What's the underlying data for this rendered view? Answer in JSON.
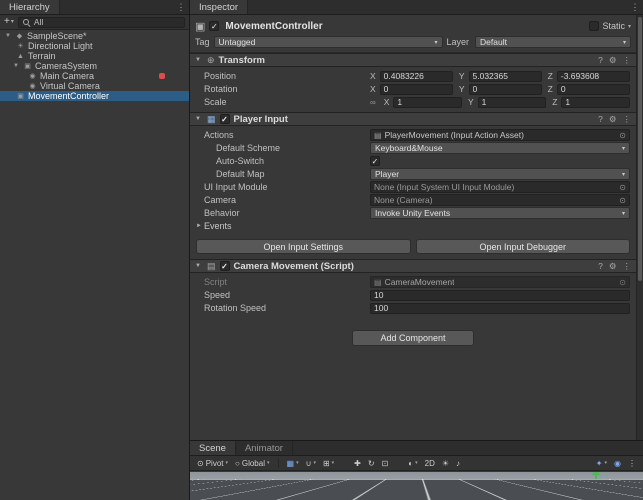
{
  "colors": {
    "selection_blue": "#2C5D87",
    "panel_bg": "#383838",
    "component_header_bg": "#3E3E3E",
    "field_bg": "#2A2A2A",
    "button_bg": "#585858",
    "active_icon_blue": "#7BAAF7",
    "warning_red": "#E04B4B",
    "gizmo_green": "#4CBB4C"
  },
  "icons": {
    "menu_dots": "⋮",
    "dropdown_arrow": "▾",
    "foldout_open": "▼",
    "foldout_closed": "►",
    "plus": "+",
    "check": "✓",
    "help": "?",
    "preset": "⚙",
    "object_picker": "⊙",
    "link": "∞",
    "scene": "◆",
    "light": "☀",
    "terrain": "▲",
    "gameobject": "▣",
    "camera": "◉",
    "transform_tool": "⊕",
    "gamepad": "▦",
    "script": "▤",
    "asset": "▤",
    "pivot": "⊙",
    "globe": "○",
    "grid": "▦",
    "snap": "⊞",
    "magnet": "∪",
    "pan": "✚",
    "orbit": "↻",
    "frame": "⊡",
    "shaded": "◐",
    "audio": "♪",
    "effects": "✦",
    "gizmo": "◉"
  },
  "hierarchy": {
    "tab_label": "Hierarchy",
    "search_label": "All",
    "scene_label": "SampleScene*",
    "items": [
      {
        "label": "Directional Light"
      },
      {
        "label": "Terrain"
      },
      {
        "label": "CameraSystem"
      },
      {
        "label": "Main Camera"
      },
      {
        "label": "Virtual Camera"
      },
      {
        "label": "MovementController"
      }
    ]
  },
  "inspector": {
    "tab_label": "Inspector",
    "game_object": {
      "name": "MovementController",
      "static_label": "Static",
      "tag_label": "Tag",
      "tag_value": "Untagged",
      "layer_label": "Layer",
      "layer_value": "Default"
    },
    "transform": {
      "title": "Transform",
      "axis": {
        "x": "X",
        "y": "Y",
        "z": "Z"
      },
      "position": {
        "label": "Position",
        "x": "0.4083226",
        "y": "5.032365",
        "z": "-3.693608"
      },
      "rotation": {
        "label": "Rotation",
        "x": "0",
        "y": "0",
        "z": "0"
      },
      "scale": {
        "label": "Scale",
        "x": "1",
        "y": "1",
        "z": "1"
      }
    },
    "player_input": {
      "title": "Player Input",
      "actions_label": "Actions",
      "actions_value": "PlayerMovement (Input Action Asset)",
      "default_scheme_label": "Default Scheme",
      "default_scheme_value": "Keyboard&Mouse",
      "auto_switch_label": "Auto-Switch",
      "default_map_label": "Default Map",
      "default_map_value": "Player",
      "ui_module_label": "UI Input Module",
      "ui_module_value": "None (Input System UI Input Module)",
      "camera_label": "Camera",
      "camera_value": "None (Camera)",
      "behavior_label": "Behavior",
      "behavior_value": "Invoke Unity Events",
      "events_label": "Events",
      "open_settings_label": "Open Input Settings",
      "open_debugger_label": "Open Input Debugger"
    },
    "camera_movement": {
      "title": "Camera Movement (Script)",
      "script_label": "Script",
      "script_value": "CameraMovement",
      "speed_label": "Speed",
      "speed_value": "10",
      "rotation_speed_label": "Rotation Speed",
      "rotation_speed_value": "100"
    },
    "add_component_label": "Add Component"
  },
  "scene_view": {
    "tabs": [
      {
        "label": "Scene"
      },
      {
        "label": "Animator"
      }
    ],
    "toolbar": {
      "pivot_label": "Pivot",
      "global_label": "Global",
      "mode_2d_label": "2D"
    }
  }
}
